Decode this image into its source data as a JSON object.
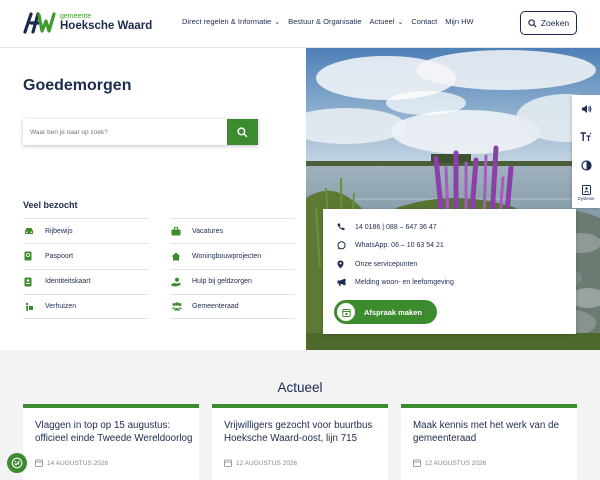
{
  "header": {
    "logo_small": "gemeente",
    "logo_big": "Hoeksche Waard",
    "nav": [
      {
        "label": "Direct regelen & Informatie",
        "dropdown": true
      },
      {
        "label": "Bestuur & Organisatie",
        "dropdown": false
      },
      {
        "label": "Actueel",
        "dropdown": true
      },
      {
        "label": "Contact",
        "dropdown": false
      },
      {
        "label": "Mijn HW",
        "dropdown": false
      }
    ],
    "search_button": "Zoeken"
  },
  "greeting": "Goedemorgen",
  "search": {
    "placeholder": "Waar ben je naar op zoek?"
  },
  "visited": {
    "title": "Veel bezocht",
    "left": [
      {
        "label": "Rijbewijs",
        "icon": "car-icon"
      },
      {
        "label": "Paspoort",
        "icon": "passport-icon"
      },
      {
        "label": "Identiteitskaart",
        "icon": "id-card-icon"
      },
      {
        "label": "Verhuizen",
        "icon": "moving-icon"
      }
    ],
    "right": [
      {
        "label": "Vacatures",
        "icon": "briefcase-icon"
      },
      {
        "label": "Woningbouwprojecten",
        "icon": "house-icon"
      },
      {
        "label": "Hulp bij geldzorgen",
        "icon": "hand-coin-icon"
      },
      {
        "label": "Gemeenteraad",
        "icon": "people-icon"
      }
    ]
  },
  "accessibility": {
    "dyslexia_label": "Dyslexie"
  },
  "contact": {
    "phone": "14 0186 | 088 – 647 36 47",
    "whatsapp": "WhatsApp: 06 – 10 63 54 21",
    "service_points": "Onze servicepunten",
    "report": "Melding woon- en leefomgeving",
    "appointment": "Afspraak maken"
  },
  "news": {
    "title": "Actueel",
    "items": [
      {
        "title": "Vlaggen in top op 15 augustus: officieel einde Tweede Wereldoorlog",
        "date": "14 AUGUSTUS 2026"
      },
      {
        "title": "Vrijwilligers gezocht voor buurtbus Hoeksche Waard-oost, lijn 715",
        "date": "12 AUGUSTUS 2026"
      },
      {
        "title": "Maak kennis met het werk van de gemeenteraad",
        "date": "12 AUGUSTUS 2026"
      }
    ]
  },
  "colors": {
    "brand_green": "#3d8b2f",
    "navy": "#1d2b4e"
  }
}
